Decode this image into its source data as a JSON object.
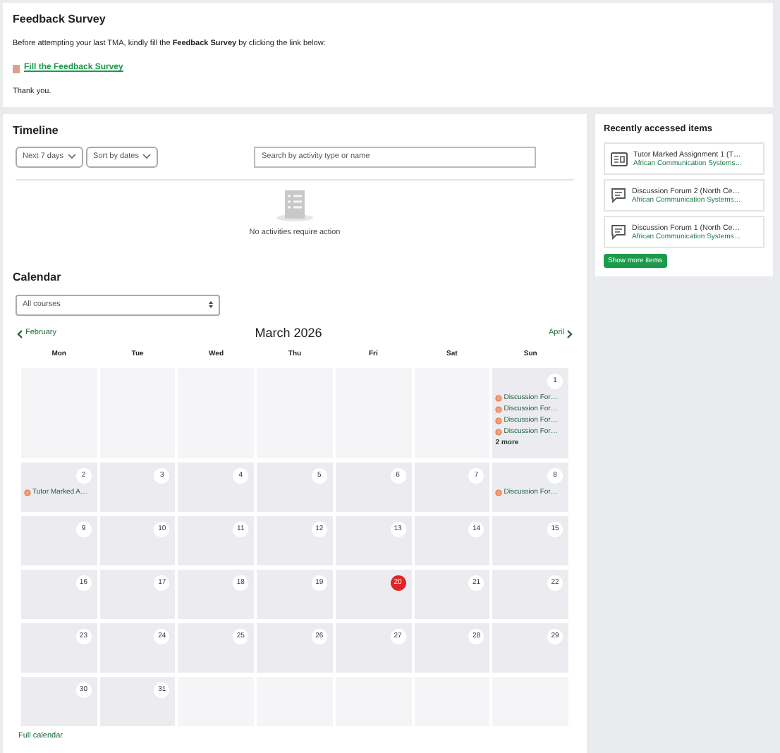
{
  "survey": {
    "title": "Feedback Survey",
    "text": "Before attempting your last TMA, kindly fill the **Feedback Survey** by clicking the link below:",
    "link": "Fill the Feedback Survey",
    "closing": "Thank you."
  },
  "timeline": {
    "title": "Timeline",
    "filters": [
      "Next 7 days",
      "Sort by dates"
    ],
    "search": {
      "placeholder": "Search by activity type or name"
    },
    "empty": "No activities require action"
  },
  "calendar": {
    "title": "Calendar",
    "course_select": "All courses",
    "prev": "February",
    "next": "April",
    "month": "March 2026",
    "weekdays": [
      "Mon",
      "Tue",
      "Wed",
      "Thu",
      "Fri",
      "Sat",
      "Sun"
    ],
    "weeks": [
      [
        {
          "kind": "blank"
        },
        {
          "kind": "blank"
        },
        {
          "kind": "blank"
        },
        {
          "kind": "blank"
        },
        {
          "kind": "blank"
        },
        {
          "kind": "blank"
        },
        {
          "kind": "day",
          "day": "1",
          "today": false,
          "events": [
            "Discussion For…",
            "Discussion For…",
            "Discussion For…",
            "Discussion For…"
          ],
          "more": "2 more"
        }
      ],
      [
        {
          "kind": "day",
          "day": "2",
          "today": false,
          "events": [
            "Tutor Marked A…"
          ]
        },
        {
          "kind": "day",
          "day": "3",
          "today": false
        },
        {
          "kind": "day",
          "day": "4",
          "today": false
        },
        {
          "kind": "day",
          "day": "5",
          "today": false
        },
        {
          "kind": "day",
          "day": "6",
          "today": false
        },
        {
          "kind": "day",
          "day": "7",
          "today": false
        },
        {
          "kind": "day",
          "day": "8",
          "today": false,
          "events": [
            "Discussion For…"
          ]
        }
      ],
      [
        {
          "kind": "day",
          "day": "9",
          "today": false
        },
        {
          "kind": "day",
          "day": "10",
          "today": false
        },
        {
          "kind": "day",
          "day": "11",
          "today": false
        },
        {
          "kind": "day",
          "day": "12",
          "today": false
        },
        {
          "kind": "day",
          "day": "13",
          "today": false
        },
        {
          "kind": "day",
          "day": "14",
          "today": false
        },
        {
          "kind": "day",
          "day": "15",
          "today": false
        }
      ],
      [
        {
          "kind": "day",
          "day": "16",
          "today": false
        },
        {
          "kind": "day",
          "day": "17",
          "today": false
        },
        {
          "kind": "day",
          "day": "18",
          "today": false
        },
        {
          "kind": "day",
          "day": "19",
          "today": false
        },
        {
          "kind": "day",
          "day": "20",
          "today": true
        },
        {
          "kind": "day",
          "day": "21",
          "today": false
        },
        {
          "kind": "day",
          "day": "22",
          "today": false
        }
      ],
      [
        {
          "kind": "day",
          "day": "23",
          "today": false
        },
        {
          "kind": "day",
          "day": "24",
          "today": false
        },
        {
          "kind": "day",
          "day": "25",
          "today": false
        },
        {
          "kind": "day",
          "day": "26",
          "today": false
        },
        {
          "kind": "day",
          "day": "27",
          "today": false
        },
        {
          "kind": "day",
          "day": "28",
          "today": false
        },
        {
          "kind": "day",
          "day": "29",
          "today": false
        }
      ],
      [
        {
          "kind": "day",
          "day": "30",
          "today": false
        },
        {
          "kind": "day",
          "day": "31",
          "today": false
        },
        {
          "kind": "blank"
        },
        {
          "kind": "blank"
        },
        {
          "kind": "blank"
        },
        {
          "kind": "blank"
        },
        {
          "kind": "blank"
        }
      ]
    ],
    "footer_link": "Full calendar"
  },
  "recent": {
    "title": "Recently accessed items",
    "items": [
      {
        "kind": "assignment",
        "name": "Tutor Marked Assignment 1 (T…",
        "course": "African Communication Systems…"
      },
      {
        "kind": "forum",
        "name": "Discussion Forum 2 (North Ce…",
        "course": "African Communication Systems…"
      },
      {
        "kind": "forum",
        "name": "Discussion Forum 1 (North Ce…",
        "course": "African Communication Systems…"
      }
    ],
    "button": "Show more items"
  }
}
